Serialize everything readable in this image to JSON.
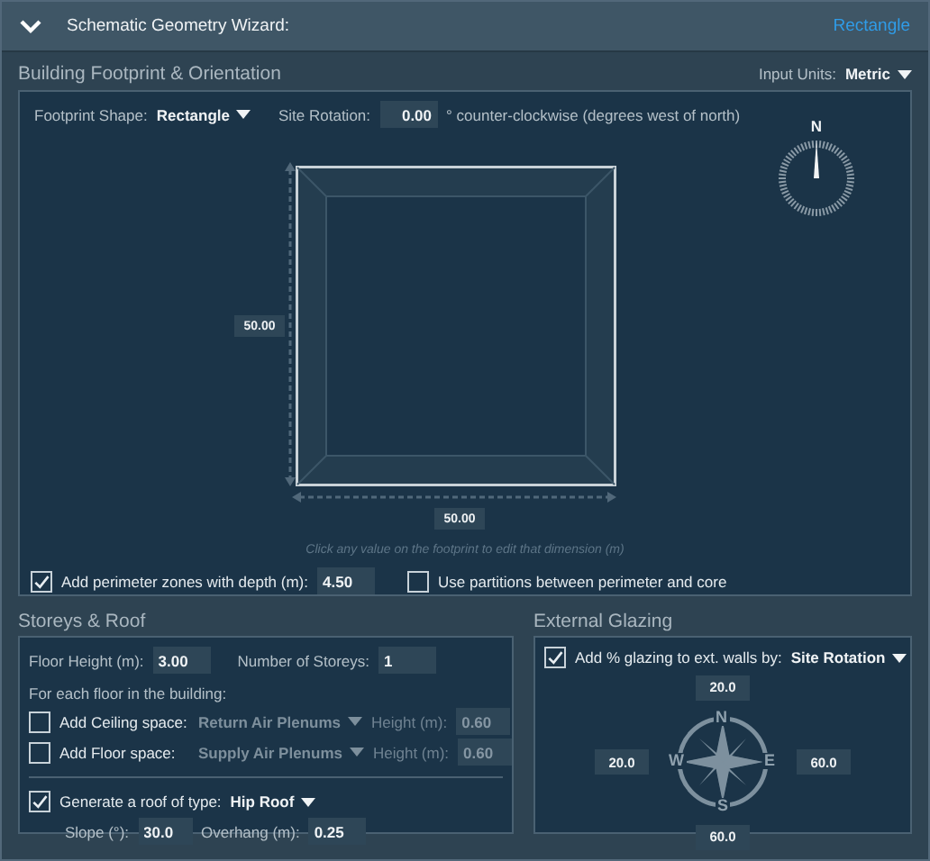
{
  "header": {
    "title": "Schematic Geometry Wizard:",
    "expanded": true,
    "shape_link": "Rectangle"
  },
  "footprint": {
    "title": "Building Footprint & Orientation",
    "units_label": "Input Units:",
    "units_value": "Metric",
    "shape_label": "Footprint Shape:",
    "shape_value": "Rectangle",
    "rotation_label": "Site Rotation:",
    "rotation_value": "0.00",
    "rotation_note": "° counter-clockwise (degrees west of north)",
    "north_label": "N",
    "depth_value": "50.00",
    "width_value": "50.00",
    "hint": "Click any value on the footprint to edit that dimension (m)",
    "perimeter": {
      "label": "Add perimeter zones with depth (m):",
      "checked": true,
      "value": "4.50"
    },
    "partitions": {
      "label": "Use partitions between perimeter and core",
      "checked": false
    }
  },
  "storeys": {
    "title": "Storeys & Roof",
    "floor_height_label": "Floor Height (m):",
    "floor_height_value": "3.00",
    "count_label": "Number of Storeys:",
    "count_value": "1",
    "floor_note": "For each floor in the building:",
    "plenums": [
      {
        "label": "Add Ceiling space:",
        "checked": false,
        "type": "Return Air Plenums",
        "height_label": "Height (m):",
        "height_value": "0.60"
      },
      {
        "label": "Add Floor space:",
        "checked": false,
        "type": "Supply Air Plenums",
        "height_label": "Height (m):",
        "height_value": "0.60"
      }
    ],
    "roof": {
      "label": "Generate a roof of type:",
      "checked": true,
      "type": "Hip Roof",
      "slope_label": "Slope (°):",
      "slope_value": "30.0",
      "overhang_label": "Overhang (m):",
      "overhang_value": "0.25"
    }
  },
  "glazing": {
    "title": "External Glazing",
    "label": "Add % glazing to ext. walls by:",
    "checked": true,
    "method": "Site Rotation",
    "rose_letters": [
      "N",
      "E",
      "S",
      "W"
    ],
    "north": "20.0",
    "west": "20.0",
    "east": "60.0",
    "south": "60.0"
  }
}
